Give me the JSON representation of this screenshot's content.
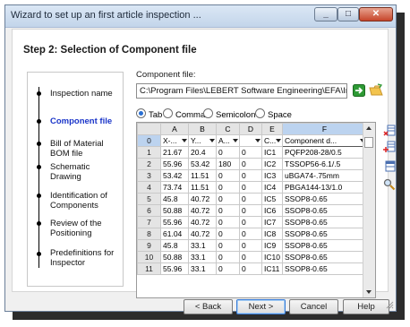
{
  "window": {
    "title": "Wizard to set up an first article inspection ..."
  },
  "step_title": "Step 2: Selection of Component file",
  "steps": [
    {
      "label": "Inspection name",
      "active": false
    },
    {
      "label": "Component file",
      "active": true
    },
    {
      "label": "Bill of Material BOM file",
      "active": false
    },
    {
      "label": "Schematic Drawing",
      "active": false
    },
    {
      "label": "Identification of Components",
      "active": false
    },
    {
      "label": "Review of the Positioning",
      "active": false
    },
    {
      "label": "Predefinitions for Inspector",
      "active": false
    }
  ],
  "component_file": {
    "label": "Component file:",
    "value": "C:\\Program Files\\LEBERT Software Engineering\\EFA\\Inspection"
  },
  "delimiters": [
    {
      "label": "Tab",
      "checked": true
    },
    {
      "label": "Comma",
      "checked": false
    },
    {
      "label": "Semicolon",
      "checked": false
    },
    {
      "label": "Space",
      "checked": false
    }
  ],
  "grid": {
    "columns": [
      "A",
      "B",
      "C",
      "D",
      "E",
      "F"
    ],
    "field_row_num": "0",
    "field_headers": [
      "X-...",
      "Y...",
      "A...",
      "",
      "C...",
      "Component d..."
    ],
    "rows": [
      {
        "n": "1",
        "cells": [
          "21.67",
          "20.4",
          "0",
          "0",
          "IC1",
          "PQFP208-28/0.5"
        ]
      },
      {
        "n": "2",
        "cells": [
          "55.96",
          "53.42",
          "180",
          "0",
          "IC2",
          "TSSOP56-6.1/.5"
        ]
      },
      {
        "n": "3",
        "cells": [
          "53.42",
          "11.51",
          "0",
          "0",
          "IC3",
          "uBGA74-.75mm"
        ]
      },
      {
        "n": "4",
        "cells": [
          "73.74",
          "11.51",
          "0",
          "0",
          "IC4",
          "PBGA144-13/1.0"
        ]
      },
      {
        "n": "5",
        "cells": [
          "45.8",
          "40.72",
          "0",
          "0",
          "IC5",
          "SSOP8-0.65"
        ]
      },
      {
        "n": "6",
        "cells": [
          "50.88",
          "40.72",
          "0",
          "0",
          "IC6",
          "SSOP8-0.65"
        ]
      },
      {
        "n": "7",
        "cells": [
          "55.96",
          "40.72",
          "0",
          "0",
          "IC7",
          "SSOP8-0.65"
        ]
      },
      {
        "n": "8",
        "cells": [
          "61.04",
          "40.72",
          "0",
          "0",
          "IC8",
          "SSOP8-0.65"
        ]
      },
      {
        "n": "9",
        "cells": [
          "45.8",
          "33.1",
          "0",
          "0",
          "IC9",
          "SSOP8-0.65"
        ]
      },
      {
        "n": "10",
        "cells": [
          "50.88",
          "33.1",
          "0",
          "0",
          "IC10",
          "SSOP8-0.65"
        ]
      },
      {
        "n": "11",
        "cells": [
          "55.96",
          "33.1",
          "0",
          "0",
          "IC11",
          "SSOP8-0.65"
        ]
      }
    ]
  },
  "buttons": {
    "back": "< Back",
    "next": "Next >",
    "cancel": "Cancel",
    "help": "Help"
  },
  "icons": {
    "open": "open-folder-icon",
    "apply": "green-arrow-icon",
    "side": [
      "delete-column-icon",
      "insert-column-icon",
      "set-header-icon",
      "search-icon"
    ]
  },
  "colors": {
    "active_step": "#1a35c9",
    "selection": "#bcd3ef"
  }
}
